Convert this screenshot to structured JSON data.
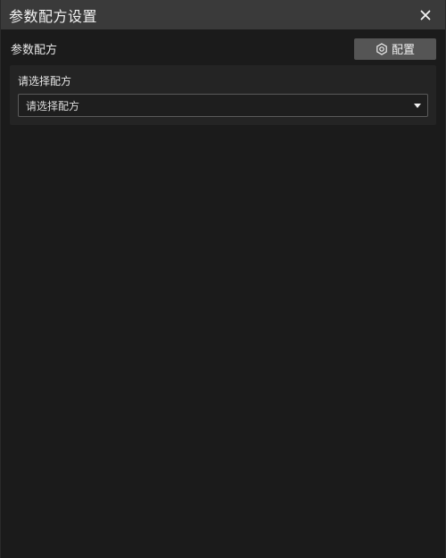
{
  "dialog": {
    "title": "参数配方设置"
  },
  "section": {
    "title": "参数配方",
    "config_button_label": "配置"
  },
  "recipe_select": {
    "label": "请选择配方",
    "value": "请选择配方"
  },
  "icons": {
    "close": "close-icon",
    "config": "gear-icon",
    "dropdown": "caret-down-icon"
  },
  "colors": {
    "background": "#1b1b1b",
    "titlebar": "#3a3a3a",
    "panel": "#242424",
    "button": "#555555"
  }
}
